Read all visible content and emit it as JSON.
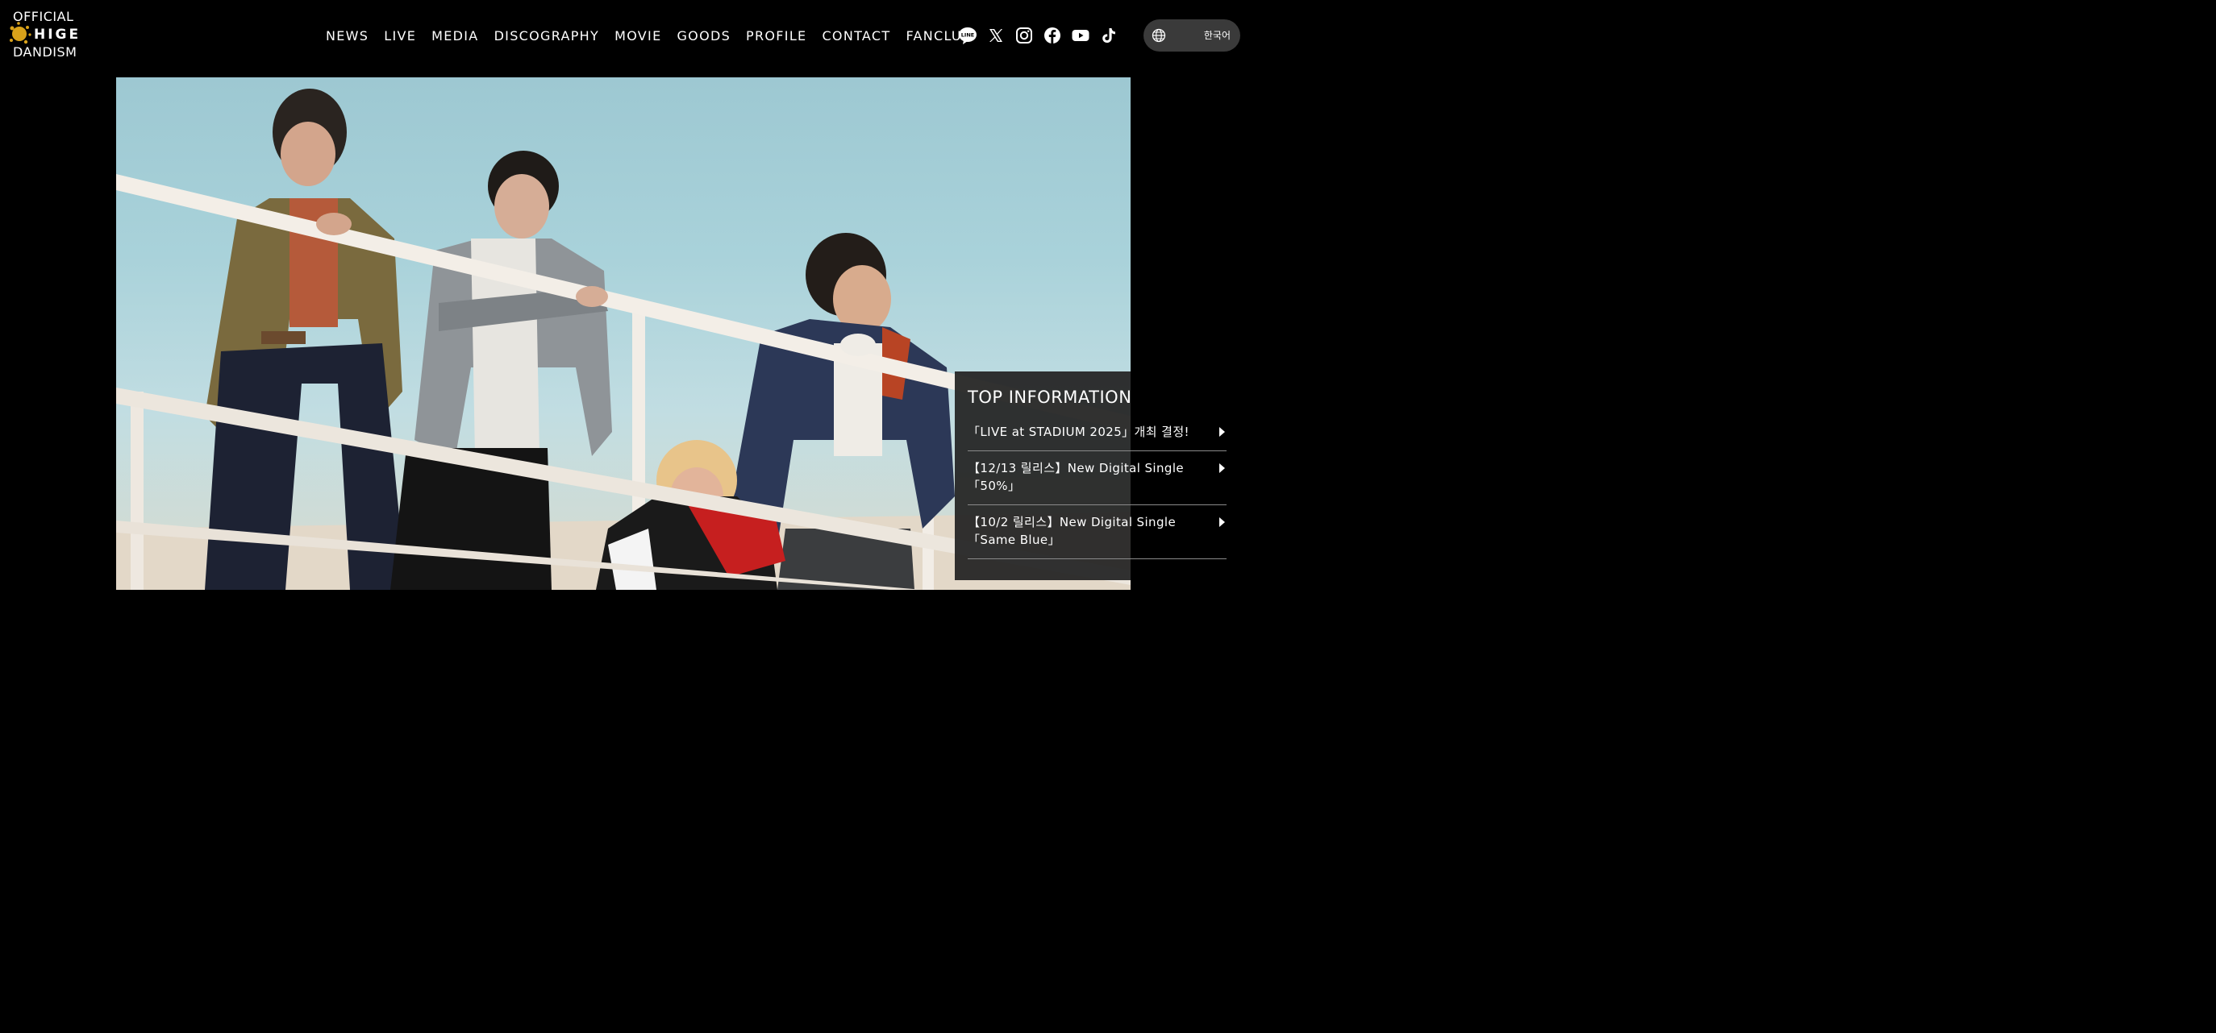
{
  "logo": {
    "line1": "OFFICIAL",
    "line2": "HIGE",
    "line3": "DANDISM",
    "accent_color": "#d9a21a"
  },
  "nav": {
    "items": [
      {
        "label": "NEWS"
      },
      {
        "label": "LIVE"
      },
      {
        "label": "MEDIA"
      },
      {
        "label": "DISCOGRAPHY"
      },
      {
        "label": "MOVIE"
      },
      {
        "label": "GOODS"
      },
      {
        "label": "PROFILE"
      },
      {
        "label": "CONTACT"
      },
      {
        "label": "FANCLUB"
      }
    ]
  },
  "social": {
    "icons": [
      "line-icon",
      "x-icon",
      "instagram-icon",
      "facebook-icon",
      "youtube-icon",
      "tiktok-icon"
    ],
    "line_text": "LINE"
  },
  "language": {
    "label": "한국어",
    "icon": "globe-icon"
  },
  "hero": {
    "image": "band-photo"
  },
  "top_information": {
    "title": "TOP INFORMATION",
    "items": [
      {
        "line1": "「LIVE at STADIUM 2025」개최 결정!",
        "line2": ""
      },
      {
        "line1": "【12/13 릴리스】New Digital Single",
        "line2": "「50%」"
      },
      {
        "line1": "【10/2 릴리스】New Digital Single",
        "line2": "「Same Blue」"
      }
    ]
  },
  "colors": {
    "background": "#000000",
    "panel": "#262626",
    "lang_pill": "#3a3a3a",
    "sky": "#a9d2da"
  }
}
